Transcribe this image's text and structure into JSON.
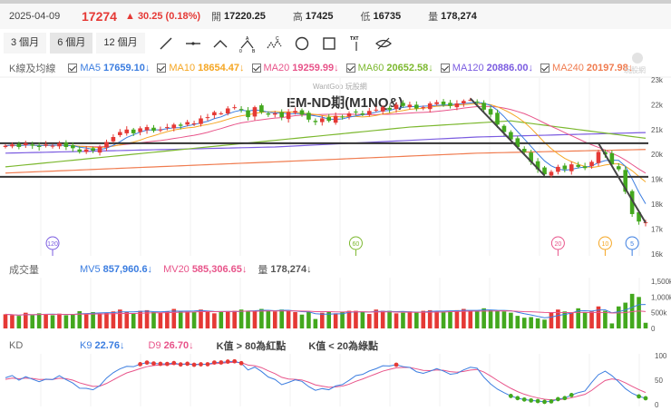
{
  "header": {
    "date": "2025-04-09",
    "price": "17274",
    "change": "▲ 30.25 (0.18%)",
    "open_label": "開",
    "open": "17220.25",
    "high_label": "高",
    "high": "17425",
    "low_label": "低",
    "low": "16735",
    "vol_label": "量",
    "vol": "178,274"
  },
  "toolbar": {
    "ranges": [
      "3 個月",
      "6 個月",
      "12 個月"
    ],
    "active_range": "6 個月",
    "tools": [
      "line-tool-icon",
      "horizontal-line-tool-icon",
      "angle-tool-icon",
      "abc-pattern-tool-icon",
      "abcd-pattern-tool-icon",
      "circle-tool-icon",
      "rectangle-tool-icon",
      "text-tool-icon",
      "hide-drawings-icon"
    ],
    "text_tool_label": "TXT"
  },
  "price_legend": {
    "label": "K線及均線",
    "items": [
      {
        "name": "MA5",
        "value": "17659.10↓",
        "color": "#3b7de0"
      },
      {
        "name": "MA10",
        "value": "18654.47↓",
        "color": "#f5a623"
      },
      {
        "name": "MA20",
        "value": "19259.99↓",
        "color": "#e8548a"
      },
      {
        "name": "MA60",
        "value": "20652.58↓",
        "color": "#7cb82f"
      },
      {
        "name": "MA120",
        "value": "20886.00↓",
        "color": "#7b5ce0"
      },
      {
        "name": "MA240",
        "value": "20197.98↓",
        "color": "#f07c50"
      }
    ]
  },
  "watermark": "WantGoo 玩股網",
  "brand": "玩股網",
  "volume_legend": {
    "label": "成交量",
    "mv5_name": "MV5",
    "mv5": "857,960.6↓",
    "mv20_name": "MV20",
    "mv20": "585,306.65↓",
    "vol_name": "量",
    "vol": "178,274↓"
  },
  "kd_legend": {
    "label": "KD",
    "k_name": "K9",
    "k": "22.76↓",
    "d_name": "D9",
    "d": "26.70↓",
    "note1": "K值 > 80為紅點",
    "note2": "K值 < 20為綠點"
  },
  "colors": {
    "up": "#e53935",
    "down": "#43a81e"
  },
  "chart_data": {
    "type": "candlestick",
    "title": "EM-ND期(M1NQ&)",
    "price_axis": {
      "ticks": [
        "23k",
        "22k",
        "21k",
        "20k",
        "19k",
        "18k",
        "17k",
        "16k"
      ],
      "range": [
        16000,
        23000
      ]
    },
    "volume_axis": {
      "ticks": [
        "1,500k",
        "1,000k",
        "500k",
        "0"
      ],
      "range": [
        0,
        1500
      ]
    },
    "kd_axis": {
      "ticks": [
        "100",
        "50",
        "0"
      ],
      "range": [
        0,
        100
      ]
    },
    "closes": [
      20350,
      20400,
      20300,
      20450,
      20350,
      20300,
      20400,
      20350,
      20450,
      20300,
      20250,
      20100,
      20200,
      20150,
      20300,
      20500,
      20700,
      20900,
      21000,
      20850,
      21050,
      21100,
      20950,
      21000,
      21100,
      21200,
      21150,
      21300,
      21250,
      21450,
      21500,
      21700,
      21650,
      21850,
      21900,
      21800,
      21500,
      21900,
      21700,
      21600,
      21650,
      21500,
      21700,
      21750,
      21600,
      21400,
      21300,
      21450,
      21350,
      21550,
      21500,
      21650,
      21700,
      21600,
      21750,
      21800,
      21900,
      21800,
      22000,
      21950,
      22000,
      21850,
      21900,
      22050,
      22100,
      22000,
      21950,
      22050,
      22150,
      22200,
      22100,
      21800,
      21600,
      21200,
      20900,
      20600,
      20300,
      20100,
      19700,
      19400,
      19200,
      19300,
      19500,
      19400,
      19600,
      19500,
      19450,
      19700,
      20100,
      20000,
      19600,
      19400,
      18500,
      17600,
      17300,
      17274
    ],
    "volumes_k": [
      450,
      420,
      400,
      500,
      420,
      480,
      450,
      420,
      470,
      420,
      460,
      550,
      460,
      520,
      480,
      500,
      540,
      600,
      520,
      480,
      560,
      580,
      520,
      500,
      540,
      620,
      560,
      540,
      520,
      600,
      560,
      480,
      520,
      550,
      560,
      600,
      540,
      560,
      620,
      560,
      540,
      600,
      560,
      520,
      440,
      520,
      300,
      500,
      520,
      480,
      520,
      560,
      560,
      520,
      460,
      600,
      560,
      560,
      480,
      500,
      540,
      520,
      560,
      580,
      560,
      540,
      560,
      580,
      620,
      560,
      540,
      640,
      580,
      560,
      540,
      500,
      400,
      340,
      360,
      320,
      280,
      500,
      600,
      540,
      520,
      640,
      520,
      540,
      700,
      560,
      160,
      700,
      820,
      1100,
      1000,
      180
    ],
    "ma120_keys": [
      [
        0,
        20050
      ],
      [
        40,
        20300
      ],
      [
        70,
        20700
      ],
      [
        95,
        20880
      ]
    ],
    "ma240_keys": [
      [
        0,
        19250
      ],
      [
        40,
        19700
      ],
      [
        70,
        20050
      ],
      [
        95,
        20200
      ]
    ],
    "ma60_keys": [
      [
        0,
        19500
      ],
      [
        30,
        20300
      ],
      [
        60,
        21100
      ],
      [
        75,
        21350
      ],
      [
        95,
        20650
      ]
    ],
    "horizontal_lines": [
      20450,
      19100
    ],
    "trend_lines": [
      [
        [
          69,
          22250
        ],
        [
          80,
          19150
        ]
      ],
      [
        [
          88,
          20450
        ],
        [
          95,
          17250
        ]
      ]
    ],
    "period_markers": [
      {
        "label": "120",
        "index": 7
      },
      {
        "label": "60",
        "index": 52
      },
      {
        "label": "20",
        "index": 82
      },
      {
        "label": "10",
        "index": 89
      },
      {
        "label": "5",
        "index": 93
      }
    ]
  }
}
